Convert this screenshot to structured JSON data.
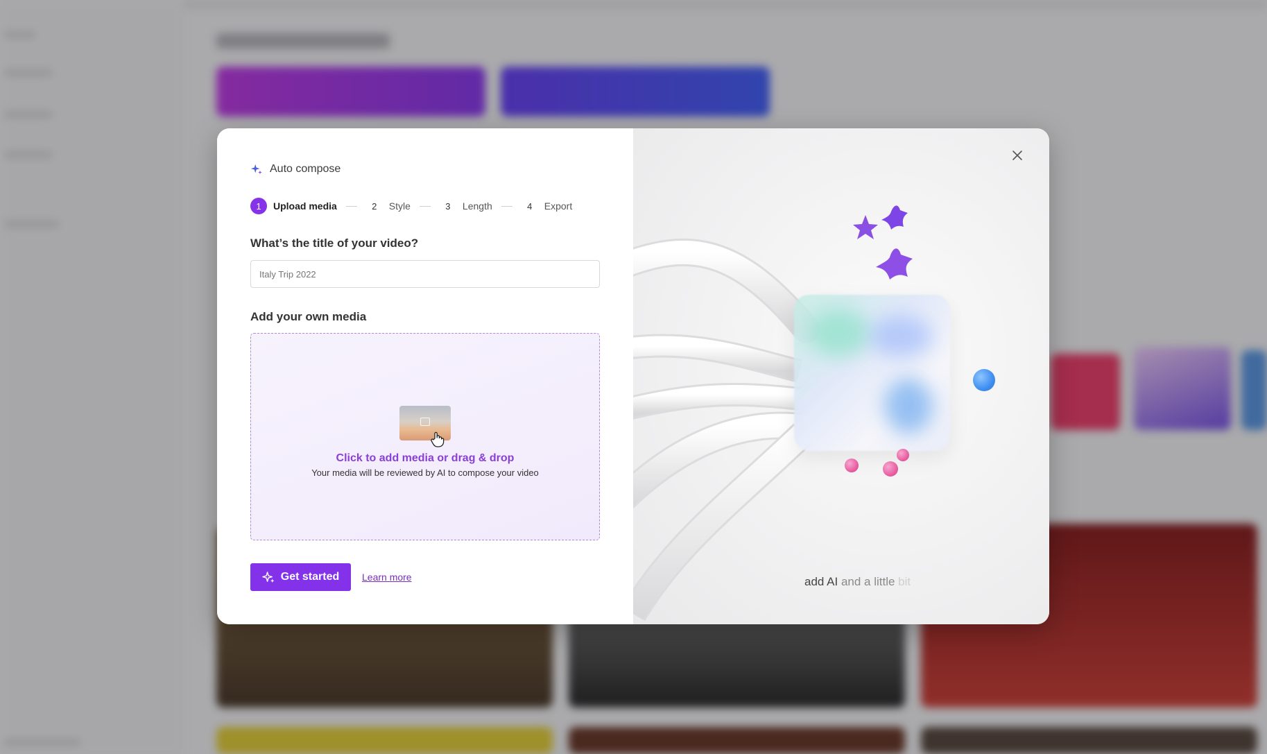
{
  "dialog": {
    "header": {
      "title": "Auto compose",
      "icon": "sparkle-icon"
    },
    "steps": [
      {
        "number": "1",
        "label": "Upload media",
        "active": true
      },
      {
        "number": "2",
        "label": "Style",
        "active": false
      },
      {
        "number": "3",
        "label": "Length",
        "active": false
      },
      {
        "number": "4",
        "label": "Export",
        "active": false
      }
    ],
    "title_question": "What’s the title of your video?",
    "title_input": {
      "value": "",
      "placeholder": "Italy Trip 2022"
    },
    "media_section_title": "Add your own media",
    "dropzone": {
      "cta": "Click to add media or drag & drop",
      "subtext": "Your media will be reviewed by AI to compose your video"
    },
    "primary_button": {
      "label": "Get started",
      "icon": "sparkle-icon"
    },
    "learn_more": "Learn more",
    "close_icon": "close-icon",
    "illustration_caption": {
      "part1": "add AI",
      "part2": " and a little",
      "part3": " bit"
    }
  },
  "colors": {
    "accent": "#8432ea",
    "link": "#7a2dbf",
    "dropzone_border": "#b08ad6",
    "orb": "#3f8ff0"
  }
}
